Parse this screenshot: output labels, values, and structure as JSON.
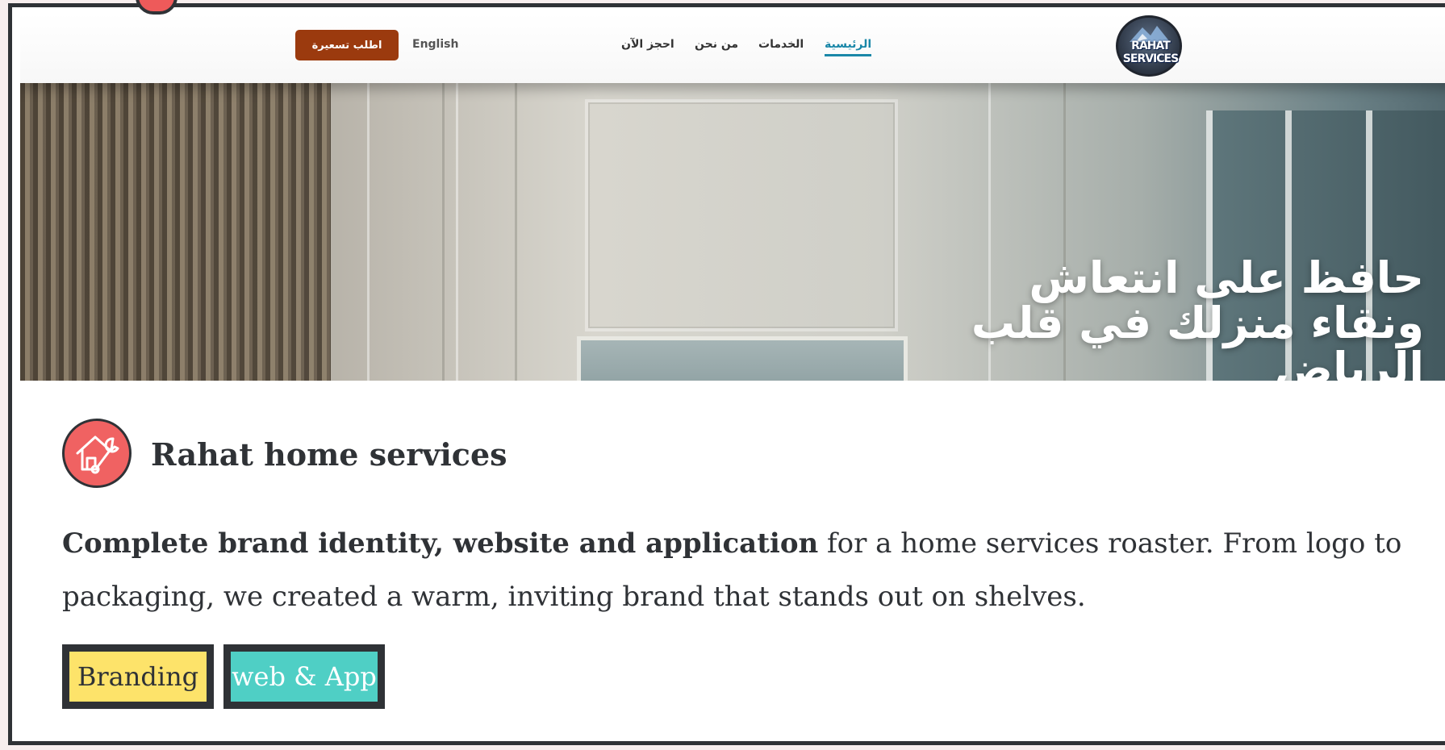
{
  "site_nav": {
    "quote_button": "اطلب تسعيرة",
    "language": "English",
    "links": [
      "احجز الآن",
      "من نحن",
      "الخدمات",
      "الرئيسية"
    ],
    "active_link": "الرئيسية",
    "logo_text": "RAHAT SERVICES"
  },
  "hero": {
    "headline": "حافظ على انتعاش\nونقاء منزلك في قلب\nالرياض"
  },
  "project": {
    "title": "Rahat home services",
    "description_bold": "Complete brand identity, website and application",
    "description_rest": " for a home services roaster. From logo to packaging, we created a warm, inviting brand that stands out on shelves.",
    "tags": [
      "Branding",
      "web & App"
    ]
  },
  "colors": {
    "card_border": "#2f3236",
    "brand_icon_bg": "#f06262",
    "tag_branding": "#fde36a",
    "tag_web": "#4fcfc5",
    "quote_button": "#9b3a0e",
    "active_link": "#1a87a8"
  },
  "icons": {
    "brand_icon": "house-wrench-icon"
  }
}
